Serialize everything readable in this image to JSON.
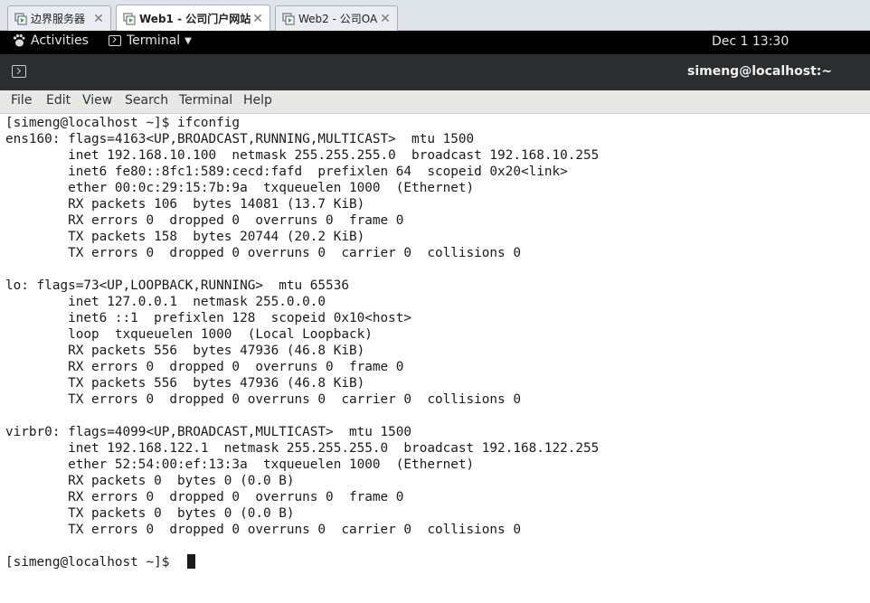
{
  "vm_tabs": [
    {
      "label": "边界服务器",
      "active": false
    },
    {
      "label": "Web1 - 公司门户网站",
      "active": true
    },
    {
      "label": "Web2 - 公司OA",
      "active": false
    }
  ],
  "topbar": {
    "activities": "Activities",
    "app_name": "Terminal",
    "clock": "Dec 1  13:30"
  },
  "window": {
    "title": "simeng@localhost:~"
  },
  "menubar": [
    "File",
    "Edit",
    "View",
    "Search",
    "Terminal",
    "Help"
  ],
  "terminal": {
    "lines": [
      "[simeng@localhost ~]$ ifconfig",
      "ens160: flags=4163<UP,BROADCAST,RUNNING,MULTICAST>  mtu 1500",
      "        inet 192.168.10.100  netmask 255.255.255.0  broadcast 192.168.10.255",
      "        inet6 fe80::8fc1:589:cecd:fafd  prefixlen 64  scopeid 0x20<link>",
      "        ether 00:0c:29:15:7b:9a  txqueuelen 1000  (Ethernet)",
      "        RX packets 106  bytes 14081 (13.7 KiB)",
      "        RX errors 0  dropped 0  overruns 0  frame 0",
      "        TX packets 158  bytes 20744 (20.2 KiB)",
      "        TX errors 0  dropped 0 overruns 0  carrier 0  collisions 0",
      "",
      "lo: flags=73<UP,LOOPBACK,RUNNING>  mtu 65536",
      "        inet 127.0.0.1  netmask 255.0.0.0",
      "        inet6 ::1  prefixlen 128  scopeid 0x10<host>",
      "        loop  txqueuelen 1000  (Local Loopback)",
      "        RX packets 556  bytes 47936 (46.8 KiB)",
      "        RX errors 0  dropped 0  overruns 0  frame 0",
      "        TX packets 556  bytes 47936 (46.8 KiB)",
      "        TX errors 0  dropped 0 overruns 0  carrier 0  collisions 0",
      "",
      "virbr0: flags=4099<UP,BROADCAST,MULTICAST>  mtu 1500",
      "        inet 192.168.122.1  netmask 255.255.255.0  broadcast 192.168.122.255",
      "        ether 52:54:00:ef:13:3a  txqueuelen 1000  (Ethernet)",
      "        RX packets 0  bytes 0 (0.0 B)",
      "        RX errors 0  dropped 0  overruns 0  frame 0",
      "        TX packets 0  bytes 0 (0.0 B)",
      "        TX errors 0  dropped 0 overruns 0  carrier 0  collisions 0",
      "",
      "[simeng@localhost ~]$ "
    ]
  },
  "icons": {
    "vm_tab": "vm-machine-icon",
    "tab_close": "close-icon",
    "activities": "gnome-foot-icon",
    "terminal": "terminal-icon"
  }
}
